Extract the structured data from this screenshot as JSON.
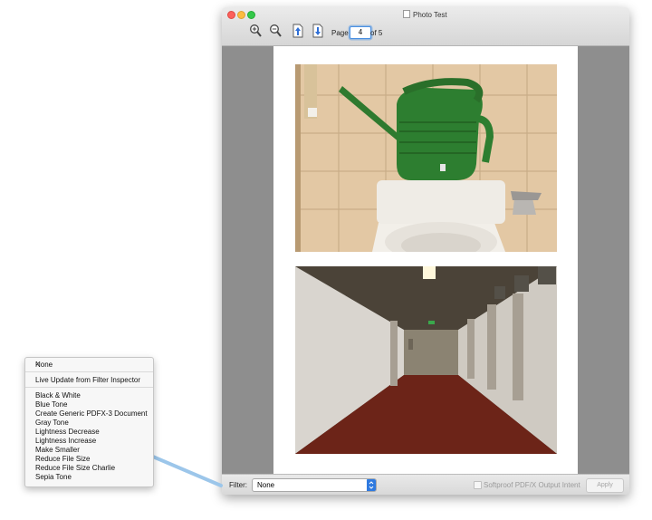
{
  "window": {
    "title": "Photo Test"
  },
  "toolbar": {
    "zoom_in_icon": "zoom-in-icon",
    "zoom_out_icon": "zoom-out-icon",
    "page_up_icon": "page-up-icon",
    "page_down_icon": "page-down-icon",
    "page_label": "Page",
    "page_value": "4",
    "page_of": "of 5"
  },
  "bottom_bar": {
    "filter_label": "Filter:",
    "filter_value": "None",
    "softproof_label": "Softproof PDF/X Output Intent",
    "softproof_checked": false,
    "apply_label": "Apply"
  },
  "menu": {
    "selected": "None",
    "items": [
      {
        "label": "None",
        "checked": true
      },
      {
        "label": "Live Update from Filter Inspector"
      },
      {
        "label": "Black & White"
      },
      {
        "label": "Blue Tone"
      },
      {
        "label": "Create Generic PDFX-3 Document"
      },
      {
        "label": "Gray Tone"
      },
      {
        "label": "Lightness Decrease"
      },
      {
        "label": "Lightness Increase"
      },
      {
        "label": "Make Smaller"
      },
      {
        "label": "Reduce File Size"
      },
      {
        "label": "Reduce File Size Charlie"
      },
      {
        "label": "Sepia Tone"
      }
    ],
    "check_mark": "✓"
  },
  "colors": {
    "watering_can": "#2e7d2e",
    "tile_wall": "#e8d2b0",
    "corridor_floor": "#6e1f14",
    "arrow": "#9cc6ea",
    "accent_blue": "#4a90e2"
  }
}
